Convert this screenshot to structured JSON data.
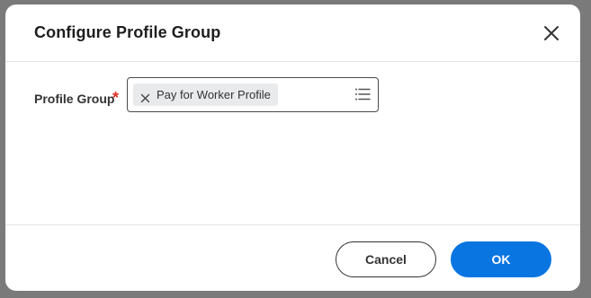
{
  "dialog": {
    "title": "Configure Profile Group",
    "close_icon": "close-icon"
  },
  "form": {
    "field_label": "Profile Group",
    "required_marker": "*",
    "selected_value": "Pay for Worker Profile",
    "remove_icon": "x-icon",
    "prompt_icon": "list-icon"
  },
  "footer": {
    "cancel_label": "Cancel",
    "ok_label": "OK"
  },
  "colors": {
    "primary": "#0875e1",
    "required": "#de2e21",
    "pill_bg": "#e9eaec"
  }
}
